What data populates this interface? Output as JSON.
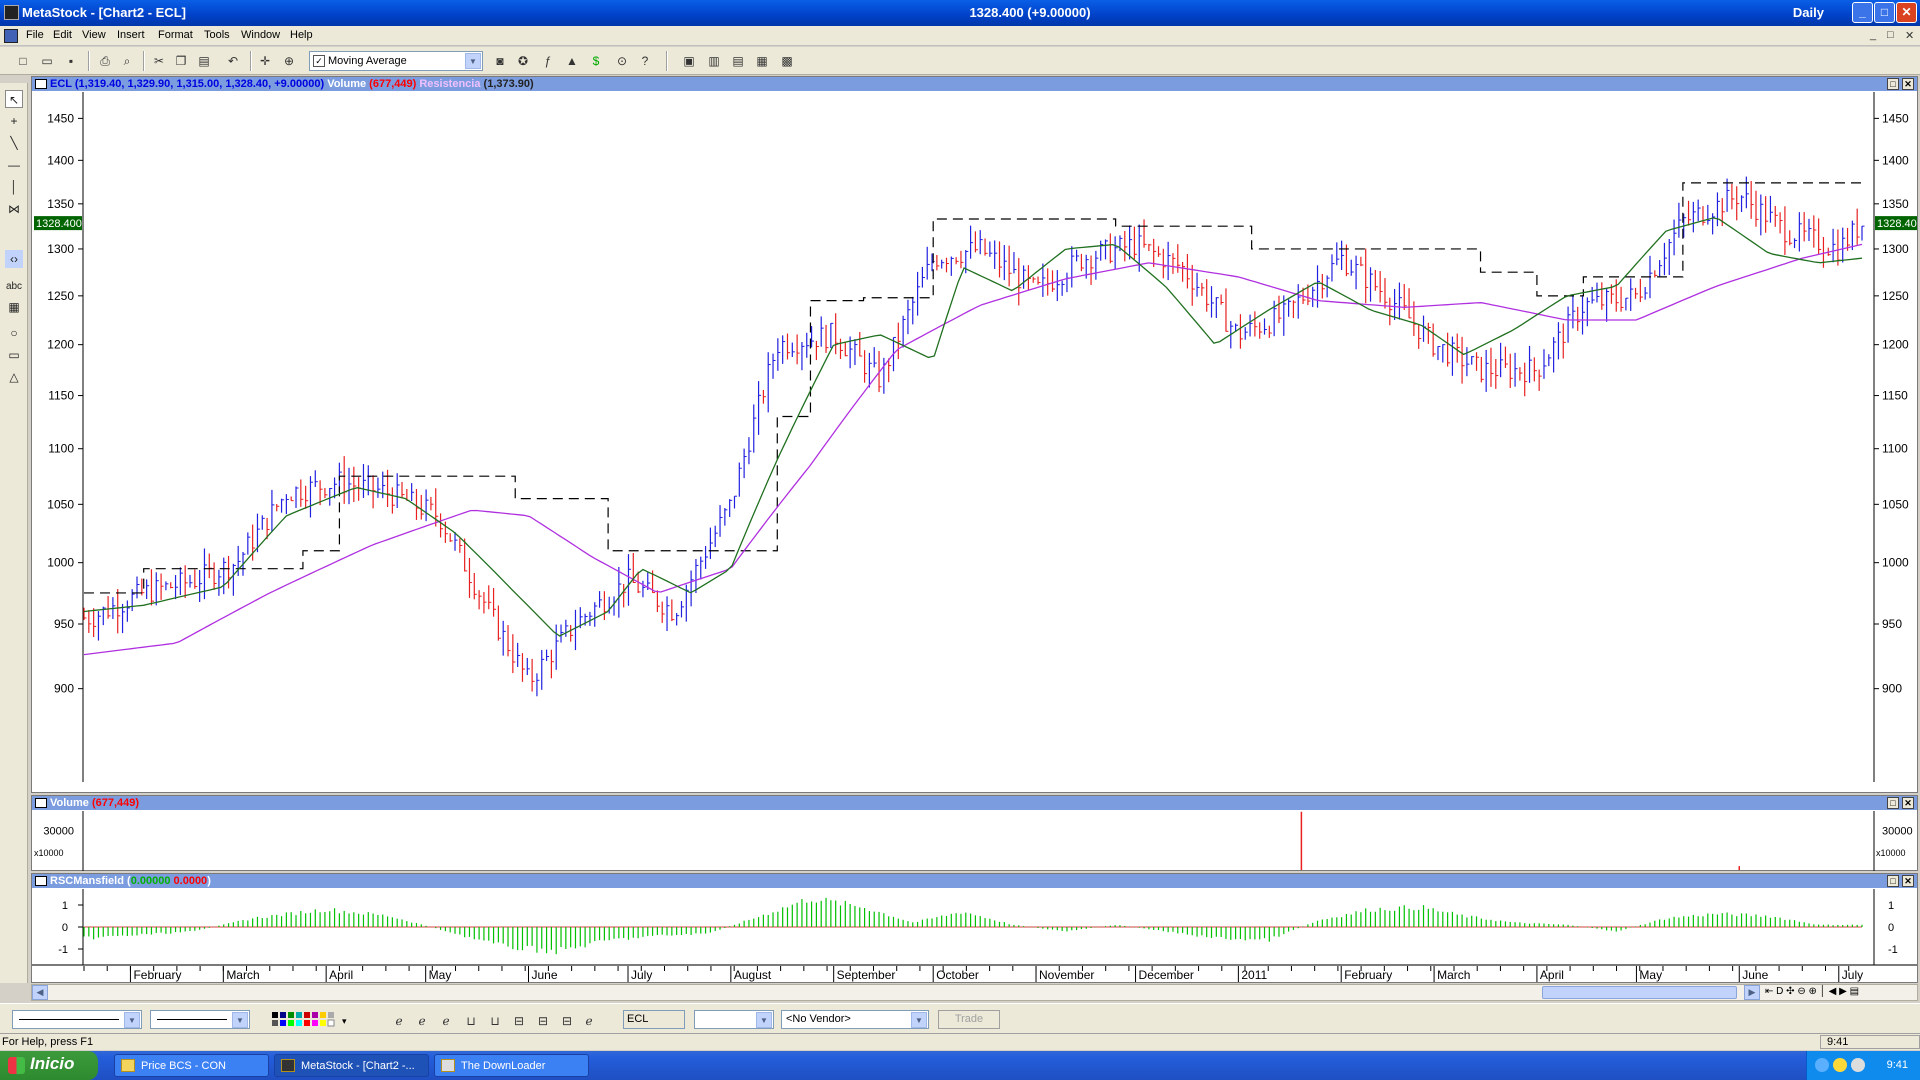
{
  "window": {
    "app_title": "MetaStock - [Chart2 - ECL]",
    "center_quote": "1328.400 (+9.00000)",
    "period": "Daily",
    "btn_min": "_",
    "btn_max": "□",
    "btn_close": "✕"
  },
  "menu": {
    "items": [
      "File",
      "Edit",
      "View",
      "Insert",
      "Format",
      "Tools",
      "Window",
      "Help"
    ],
    "mdi_min": "_",
    "mdi_restore": "□",
    "mdi_close": "✕"
  },
  "toolbar": {
    "indicator_select": "Moving Average",
    "indicator_checked": "✓"
  },
  "price_pane": {
    "header_symbol": "ECL",
    "header_ohlc": "(1,319.40, 1,329.90, 1,315.00, 1,328.40, +9.00000)",
    "header_volume_label": "Volume",
    "header_volume_value": "(677,449)",
    "header_resist_label": "Resistencia",
    "header_resist_value": "(1,373.90)",
    "last_price_tag": "1328.400",
    "y_ticks": [
      "1450",
      "1400",
      "1350",
      "1300",
      "1250",
      "1200",
      "1150",
      "1100",
      "1050",
      "1000",
      "950",
      "900"
    ]
  },
  "volume_pane": {
    "header_label": "Volume",
    "header_value": "(677,449)",
    "tick": "30000",
    "multiplier": "x10000"
  },
  "rsc_pane": {
    "header_label": "RSCMansfield",
    "header_value_green": "0.00000",
    "header_value_red": "0.0000",
    "y_ticks": [
      "1",
      "0",
      "-1"
    ]
  },
  "date_axis": {
    "labels": [
      "February",
      "March",
      "April",
      "May",
      "June",
      "July",
      "August",
      "September",
      "October",
      "November",
      "December",
      "2011",
      "February",
      "March",
      "April",
      "May",
      "June",
      "July"
    ]
  },
  "bottom_bar": {
    "security": "ECL",
    "vendor": "<No Vendor>",
    "trade": "Trade"
  },
  "status": {
    "help_text": "For Help, press F1",
    "time": "9:41"
  },
  "taskbar": {
    "start": "Inicio",
    "tasks": [
      "Price BCS - CON",
      "MetaStock - [Chart2 -...",
      "The DownLoader"
    ],
    "clock": "9:41"
  },
  "colors": {
    "up_bar": "#2020e0",
    "down_bar": "#e82020",
    "ma_short": "#207020",
    "ma_long": "#b030e0",
    "resistance": "#000000",
    "rsc_pos": "#00c000",
    "rsc_neg": "#00c000",
    "header_bg": "#7b9de0"
  },
  "chart_data": {
    "type": "line",
    "title": "ECL",
    "ylim": [
      850,
      1470
    ],
    "y_scale": "log",
    "grid": false,
    "x_range": [
      "2010-01-18",
      "2011-07-08"
    ],
    "series": [
      {
        "name": "ECL",
        "kind": "price",
        "x": [
          "2010-01-20",
          "2010-02-05",
          "2010-02-20",
          "2010-03-05",
          "2010-03-20",
          "2010-04-05",
          "2010-04-20",
          "2010-05-05",
          "2010-05-20",
          "2010-06-01",
          "2010-06-15",
          "2010-07-01",
          "2010-07-15",
          "2010-08-01",
          "2010-08-15",
          "2010-09-01",
          "2010-09-15",
          "2010-10-01",
          "2010-10-15",
          "2010-11-01",
          "2010-11-15",
          "2010-12-01",
          "2010-12-15",
          "2011-01-01",
          "2011-01-15",
          "2011-02-01",
          "2011-02-15",
          "2011-03-01",
          "2011-03-15",
          "2011-04-01",
          "2011-04-15",
          "2011-05-01",
          "2011-05-15",
          "2011-06-01",
          "2011-06-15",
          "2011-07-01",
          "2011-07-08"
        ],
        "values": [
          955,
          975,
          985,
          1000,
          1060,
          1070,
          1060,
          1040,
          960,
          905,
          950,
          985,
          960,
          1050,
          1200,
          1210,
          1165,
          1290,
          1300,
          1255,
          1290,
          1305,
          1280,
          1210,
          1230,
          1290,
          1250,
          1200,
          1175,
          1175,
          1240,
          1250,
          1330,
          1360,
          1320,
          1300,
          1328
        ]
      },
      {
        "name": "Resistencia",
        "kind": "dashed-step",
        "x": [
          "2010-01-18",
          "2010-02-05",
          "2010-03-25",
          "2010-04-05",
          "2010-05-28",
          "2010-06-25",
          "2010-07-15",
          "2010-08-15",
          "2010-08-25",
          "2010-09-10",
          "2010-10-01",
          "2010-11-25",
          "2011-01-05",
          "2011-02-01",
          "2011-03-15",
          "2011-04-01",
          "2011-04-15",
          "2011-05-15",
          "2011-07-08"
        ],
        "values": [
          975,
          995,
          1010,
          1075,
          1055,
          1010,
          1010,
          1130,
          1245,
          1248,
          1333,
          1325,
          1300,
          1300,
          1275,
          1250,
          1270,
          1373.9,
          1373.9
        ]
      },
      {
        "name": "MA short",
        "kind": "line",
        "x": [
          "2010-01-18",
          "2010-02-05",
          "2010-03-01",
          "2010-03-20",
          "2010-04-10",
          "2010-04-25",
          "2010-05-10",
          "2010-05-28",
          "2010-06-10",
          "2010-06-25",
          "2010-07-05",
          "2010-07-20",
          "2010-08-01",
          "2010-08-15",
          "2010-09-01",
          "2010-09-15",
          "2010-10-01",
          "2010-10-10",
          "2010-10-25",
          "2010-11-10",
          "2010-11-25",
          "2010-12-10",
          "2010-12-25",
          "2011-01-10",
          "2011-01-25",
          "2011-02-10",
          "2011-02-25",
          "2011-03-10",
          "2011-03-25",
          "2011-04-10",
          "2011-04-25",
          "2011-05-10",
          "2011-05-25",
          "2011-06-10",
          "2011-06-25",
          "2011-07-08"
        ],
        "values": [
          960,
          965,
          980,
          1040,
          1065,
          1055,
          1025,
          975,
          940,
          960,
          995,
          975,
          995,
          1090,
          1200,
          1210,
          1185,
          1280,
          1255,
          1300,
          1305,
          1260,
          1200,
          1235,
          1265,
          1235,
          1220,
          1190,
          1215,
          1250,
          1260,
          1320,
          1335,
          1295,
          1285,
          1290
        ]
      },
      {
        "name": "MA long",
        "kind": "line",
        "x": [
          "2010-01-18",
          "2010-02-15",
          "2010-03-15",
          "2010-04-15",
          "2010-05-15",
          "2010-06-01",
          "2010-06-20",
          "2010-07-10",
          "2010-08-01",
          "2010-08-25",
          "2010-09-20",
          "2010-10-15",
          "2010-11-10",
          "2010-12-05",
          "2011-01-01",
          "2011-01-25",
          "2011-02-20",
          "2011-03-15",
          "2011-04-10",
          "2011-05-01",
          "2011-05-25",
          "2011-06-20",
          "2011-07-08"
        ],
        "values": [
          926,
          935,
          975,
          1015,
          1045,
          1040,
          1005,
          975,
          995,
          1085,
          1195,
          1240,
          1268,
          1285,
          1270,
          1245,
          1238,
          1243,
          1225,
          1225,
          1260,
          1290,
          1305
        ]
      }
    ],
    "volume": {
      "name": "Volume",
      "ylim": [
        0,
        40000
      ],
      "unit": "x10000",
      "spikes": [
        {
          "x": "2011-01-20",
          "value": 45000
        },
        {
          "x": "2011-06-01",
          "value": 1500
        }
      ]
    },
    "indicator": {
      "name": "RSCMansfield",
      "ylim": [
        -1.5,
        1.5
      ],
      "x": [
        "2010-01-20",
        "2010-02-20",
        "2010-03-10",
        "2010-04-01",
        "2010-04-20",
        "2010-05-10",
        "2010-05-25",
        "2010-06-10",
        "2010-06-25",
        "2010-07-10",
        "2010-07-25",
        "2010-08-10",
        "2010-08-25",
        "2010-09-10",
        "2010-09-25",
        "2010-10-10",
        "2010-10-25",
        "2010-11-10",
        "2010-11-25",
        "2010-12-10",
        "2010-12-25",
        "2011-01-10",
        "2011-01-25",
        "2011-02-10",
        "2011-02-25",
        "2011-03-10",
        "2011-03-25",
        "2011-04-10",
        "2011-04-25",
        "2011-05-10",
        "2011-05-25",
        "2011-06-10",
        "2011-06-25",
        "2011-07-08"
      ],
      "values": [
        -0.5,
        -0.2,
        0.4,
        0.8,
        0.5,
        -0.3,
        -0.9,
        -1.1,
        -0.6,
        -0.4,
        -0.3,
        0.5,
        1.3,
        0.9,
        0.2,
        0.7,
        0.1,
        -0.2,
        0.1,
        -0.2,
        -0.5,
        -0.6,
        0.3,
        0.8,
        0.9,
        0.5,
        0.2,
        0.1,
        -0.2,
        0.4,
        0.6,
        0.5,
        0.1,
        0.1
      ]
    }
  }
}
